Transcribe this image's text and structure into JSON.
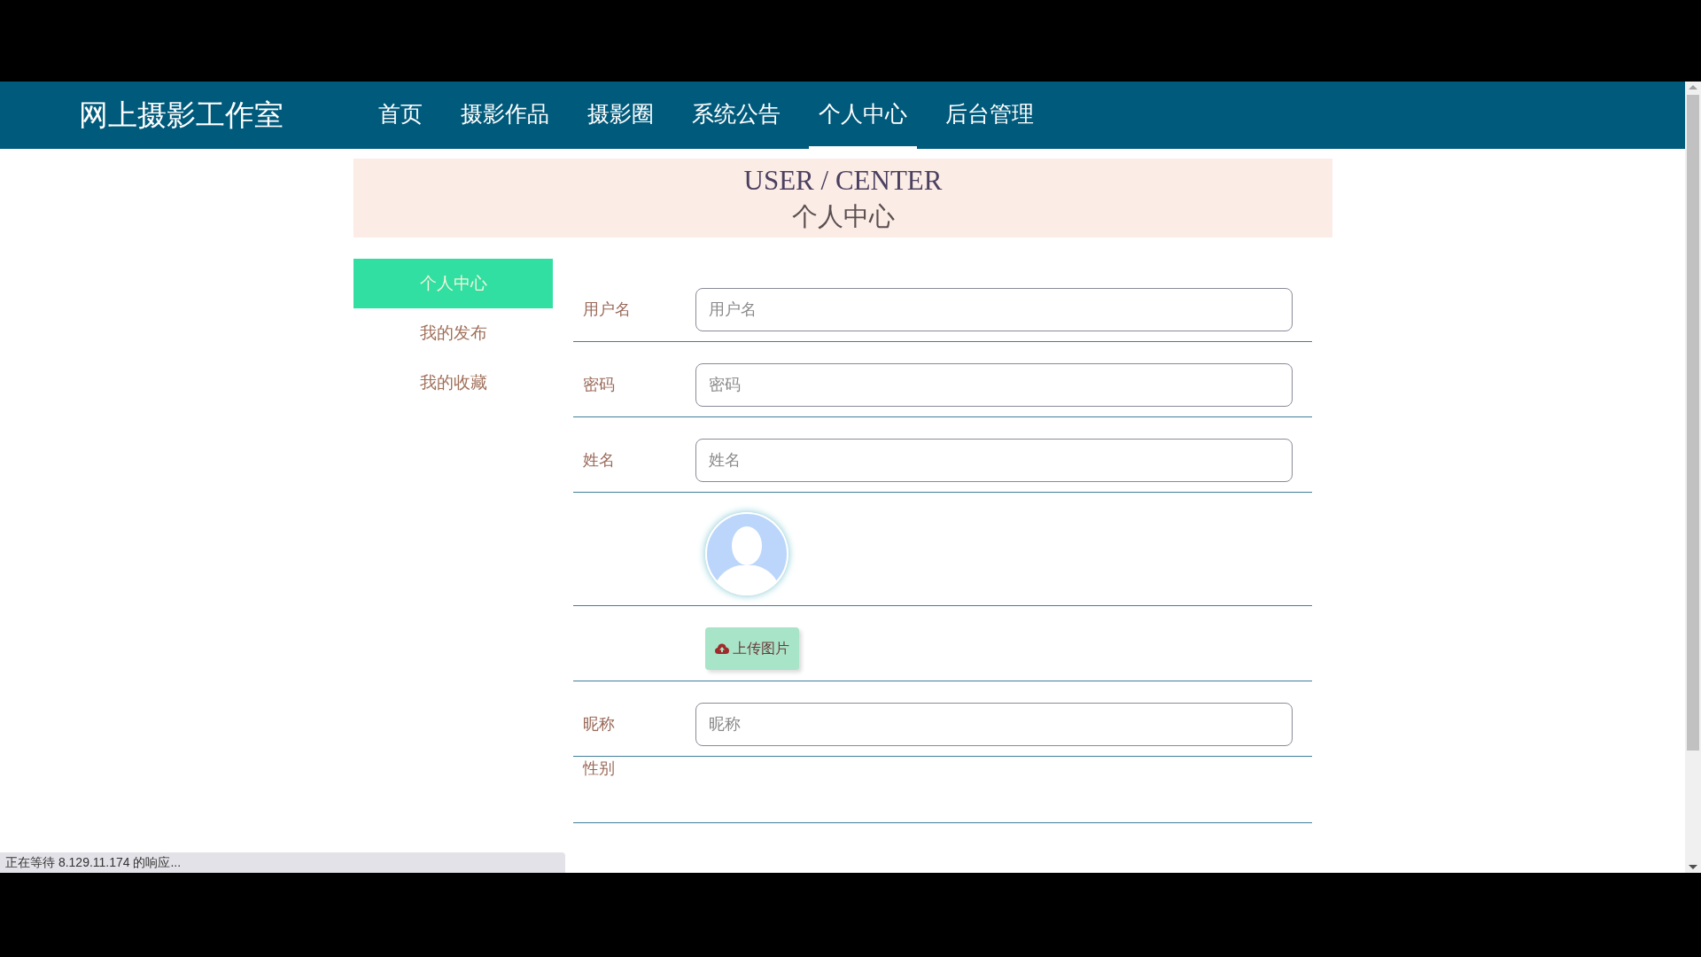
{
  "site_title": "网上摄影工作室",
  "nav": [
    {
      "label": "首页",
      "selected": false
    },
    {
      "label": "摄影作品",
      "selected": false
    },
    {
      "label": "摄影圈",
      "selected": false
    },
    {
      "label": "系统公告",
      "selected": false
    },
    {
      "label": "个人中心",
      "selected": true
    },
    {
      "label": "后台管理",
      "selected": false
    }
  ],
  "banner": {
    "title_en": "USER / CENTER",
    "title_zh": "个人中心"
  },
  "sidebar": [
    {
      "label": "个人中心",
      "selected": true
    },
    {
      "label": "我的发布",
      "selected": false
    },
    {
      "label": "我的收藏",
      "selected": false
    }
  ],
  "form": [
    {
      "kind": "input",
      "label": "用户名",
      "placeholder": "用户名"
    },
    {
      "kind": "input",
      "label": "密码",
      "placeholder": "密码"
    },
    {
      "kind": "input",
      "label": "姓名",
      "placeholder": "姓名"
    },
    {
      "kind": "avatar"
    },
    {
      "kind": "upload",
      "button": "上传图片"
    },
    {
      "kind": "input",
      "label": "昵称",
      "placeholder": "昵称"
    },
    {
      "kind": "label",
      "label": "性别"
    }
  ],
  "status_bar": "正在等待 8.129.11.174 的响应..."
}
